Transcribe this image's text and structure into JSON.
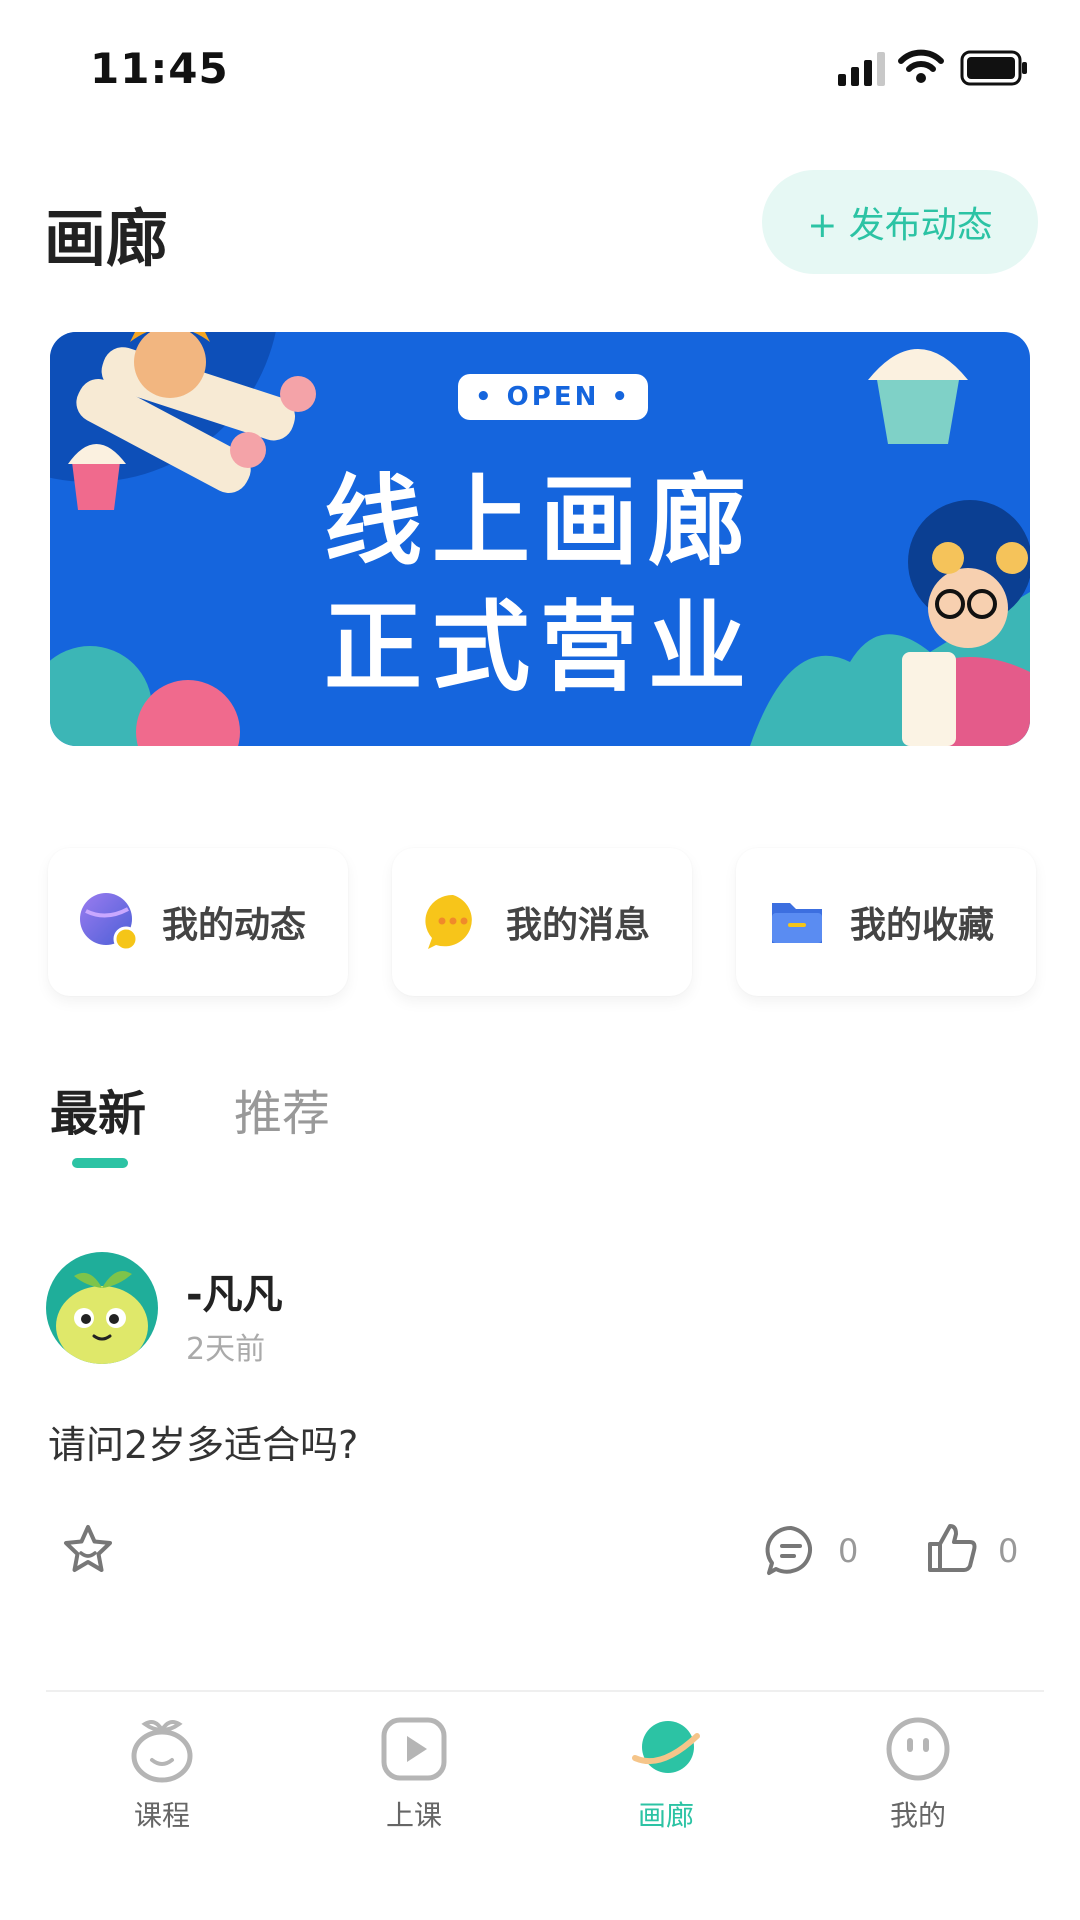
{
  "status_bar": {
    "time": "11:45"
  },
  "header": {
    "title": "画廊",
    "publish_label": "+ 发布动态"
  },
  "banner": {
    "badge": "• OPEN •",
    "line1": "线上画廊",
    "line2": "正式营业"
  },
  "shortcuts": [
    {
      "label": "我的动态",
      "icon": "planet-icon"
    },
    {
      "label": "我的消息",
      "icon": "chat-bubble-icon"
    },
    {
      "label": "我的收藏",
      "icon": "folder-icon"
    }
  ],
  "tabs": [
    {
      "label": "最新",
      "active": true
    },
    {
      "label": "推荐",
      "active": false
    }
  ],
  "post": {
    "author": "-凡凡",
    "time": "2天前",
    "content": "请问2岁多适合吗?",
    "comments": "0",
    "likes": "0"
  },
  "bottom_nav": [
    {
      "label": "课程",
      "icon": "sprout-face-icon",
      "active": false
    },
    {
      "label": "上课",
      "icon": "play-icon",
      "active": false
    },
    {
      "label": "画廊",
      "icon": "planet-icon",
      "active": true
    },
    {
      "label": "我的",
      "icon": "face-icon",
      "active": false
    }
  ],
  "colors": {
    "accent": "#2cc3a4",
    "banner_bg": "#1565dd",
    "publish_bg": "#e6f8f4"
  }
}
